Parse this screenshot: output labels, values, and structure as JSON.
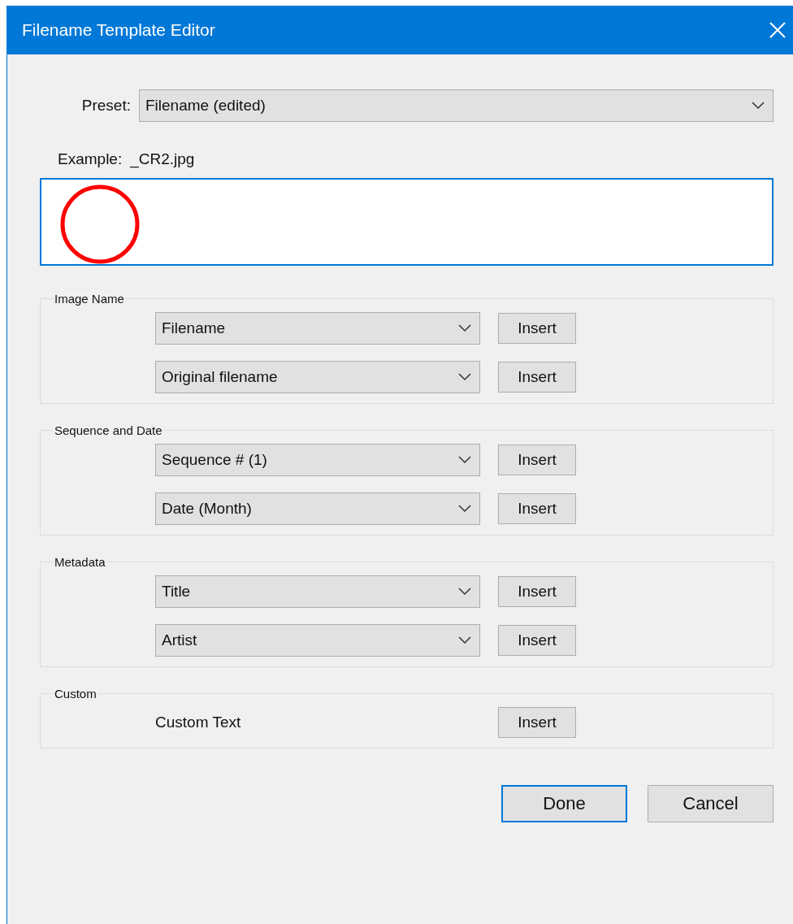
{
  "window": {
    "title": "Filename Template Editor"
  },
  "preset": {
    "label": "Preset:",
    "value": "Filename (edited)"
  },
  "example": {
    "label": "Example:",
    "value": "_CR2.jpg"
  },
  "template_field": {
    "focused": true
  },
  "groups": [
    {
      "legend": "Image Name",
      "rows": [
        {
          "kind": "dropdown",
          "value": "Filename",
          "button": "Insert"
        },
        {
          "kind": "dropdown",
          "value": "Original filename",
          "button": "Insert"
        }
      ]
    },
    {
      "legend": "Sequence and Date",
      "rows": [
        {
          "kind": "dropdown",
          "value": "Sequence # (1)",
          "button": "Insert"
        },
        {
          "kind": "dropdown",
          "value": "Date (Month)",
          "button": "Insert"
        }
      ]
    },
    {
      "legend": "Metadata",
      "rows": [
        {
          "kind": "dropdown",
          "value": "Title",
          "button": "Insert"
        },
        {
          "kind": "dropdown",
          "value": "Artist",
          "button": "Insert"
        }
      ]
    },
    {
      "legend": "Custom",
      "rows": [
        {
          "kind": "text",
          "label": "Custom Text",
          "button": "Insert"
        }
      ]
    }
  ],
  "buttons": [
    {
      "label": "Done",
      "default": true
    },
    {
      "label": "Cancel",
      "default": false
    }
  ]
}
